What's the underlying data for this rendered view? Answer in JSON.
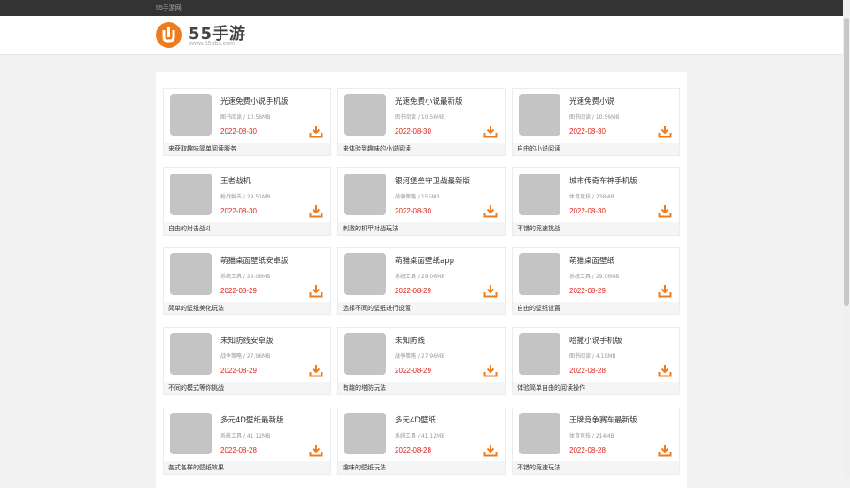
{
  "topbar": {
    "site_link": "55手游网"
  },
  "header": {
    "logo_name": "55手游",
    "logo_url": "www.55bbs.com"
  },
  "apps": [
    {
      "name": "光速免费小说手机版",
      "category": "图书阅读",
      "size": "10.56MB",
      "date": "2022-08-30",
      "desc": "来获取趣味简单阅读服务"
    },
    {
      "name": "光速免费小说最新版",
      "category": "图书阅读",
      "size": "10.56MB",
      "date": "2022-08-30",
      "desc": "来体验到趣味的小说阅读"
    },
    {
      "name": "光速免费小说",
      "category": "图书阅读",
      "size": "10.56MB",
      "date": "2022-08-30",
      "desc": "自由的小说阅读"
    },
    {
      "name": "王者战机",
      "category": "枪战射击",
      "size": "29.51MB",
      "date": "2022-08-30",
      "desc": "自由的射击战斗"
    },
    {
      "name": "银河堡垒守卫战最新版",
      "category": "战争策略",
      "size": "155MB",
      "date": "2022-08-30",
      "desc": "刺激的机甲对战玩法"
    },
    {
      "name": "城市传奇车神手机版",
      "category": "体育竞技",
      "size": "238MB",
      "date": "2022-08-30",
      "desc": "不错的竞速挑战"
    },
    {
      "name": "萌猫桌面壁纸安卓版",
      "category": "系统工具",
      "size": "29.06MB",
      "date": "2022-08-29",
      "desc": "简单的壁纸美化玩法"
    },
    {
      "name": "萌猫桌面壁纸app",
      "category": "系统工具",
      "size": "29.06MB",
      "date": "2022-08-29",
      "desc": "选择不同的壁纸进行设置"
    },
    {
      "name": "萌猫桌面壁纸",
      "category": "系统工具",
      "size": "29.06MB",
      "date": "2022-08-29",
      "desc": "自由的壁纸设置"
    },
    {
      "name": "未知防线安卓版",
      "category": "战争策略",
      "size": "27.96MB",
      "date": "2022-08-29",
      "desc": "不同的模式等你挑战"
    },
    {
      "name": "未知防线",
      "category": "战争策略",
      "size": "27.96MB",
      "date": "2022-08-29",
      "desc": "有趣的塔防玩法"
    },
    {
      "name": "哈撒小说手机版",
      "category": "图书阅读",
      "size": "4.19MB",
      "date": "2022-08-28",
      "desc": "体验简单自由的阅读操作"
    },
    {
      "name": "多元4D壁纸最新版",
      "category": "系统工具",
      "size": "41.12MB",
      "date": "2022-08-28",
      "desc": "各式各样的壁纸效果"
    },
    {
      "name": "多元4D壁纸",
      "category": "系统工具",
      "size": "41.12MB",
      "date": "2022-08-28",
      "desc": "趣味的壁纸玩法"
    },
    {
      "name": "王牌竞争赛车最新版",
      "category": "体育竞技",
      "size": "214MB",
      "date": "2022-08-28",
      "desc": "不错的竞速玩法"
    }
  ],
  "colors": {
    "topbar": "#333333",
    "accent": "#f07b1c",
    "date": "#e2231a",
    "thumbnail": "#c4c4c4"
  }
}
